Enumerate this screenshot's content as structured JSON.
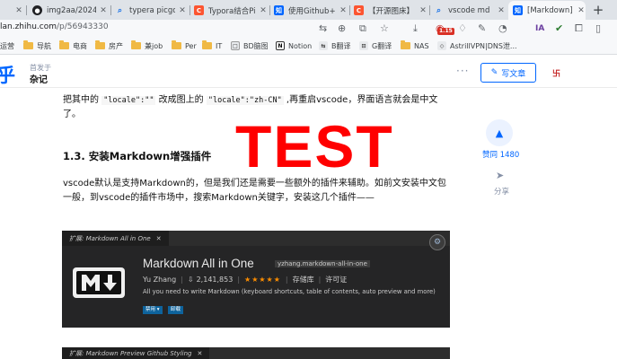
{
  "browser": {
    "tabs": [
      {
        "title": "",
        "icon": "page-icon",
        "color": "#5f6368"
      },
      {
        "title": "img2aa/2024",
        "icon": "github-icon",
        "color": "#202124"
      },
      {
        "title": "typera picgo",
        "icon": "search-icon",
        "color": "#1a73e8"
      },
      {
        "title": "Typora结合Pic",
        "icon": "csdn-icon",
        "color": "#fc5531"
      },
      {
        "title": "使用Github+p",
        "icon": "zhihu-icon",
        "color": "#0066ff"
      },
      {
        "title": "【开源图床】",
        "icon": "csdn-icon",
        "color": "#fc5531"
      },
      {
        "title": "vscode md",
        "icon": "search-icon",
        "color": "#1a73e8"
      },
      {
        "title": "[Markdown]",
        "icon": "zhihu-icon",
        "color": "#0066ff"
      }
    ],
    "url_host": "lan.zhihu.com",
    "url_path": "/p/56943330",
    "badge": "1.15"
  },
  "bookmarks": [
    {
      "label": "运营",
      "type": "folder"
    },
    {
      "label": "导航",
      "type": "folder"
    },
    {
      "label": "电商",
      "type": "folder"
    },
    {
      "label": "房产",
      "type": "folder"
    },
    {
      "label": "兼job",
      "type": "folder"
    },
    {
      "label": "Per",
      "type": "folder"
    },
    {
      "label": "IT",
      "type": "folder"
    },
    {
      "label": "BD脑图",
      "type": "site"
    },
    {
      "label": "Notion",
      "type": "site"
    },
    {
      "label": "B翻译",
      "type": "site"
    },
    {
      "label": "G翻译",
      "type": "site"
    },
    {
      "label": "NAS",
      "type": "folder"
    },
    {
      "label": "AstrillVPN|DNS泄...",
      "type": "site"
    }
  ],
  "zhihu": {
    "logo": "乎",
    "published_in_label": "首发于",
    "column_name": "杂记",
    "more": "···",
    "write_button": "写文章"
  },
  "article": {
    "para1_pre": "把其中的 ",
    "para1_code1": "\"locale\":\"\"",
    "para1_mid": " 改成图上的 ",
    "para1_code2": "\"locale\":\"zh-CN\"",
    "para1_post": " ,再重启vscode，界面语言就会是中文了。",
    "heading": "1.3. 安装Markdown增强插件",
    "para2": "vscode默认是支持Markdown的，但是我们还是需要一些额外的插件来辅助。如前文安装中文包一般，到vscode的插件市场中，搜索Markdown关键字，安装这几个插件——",
    "watermark": "TEST"
  },
  "sidebar": {
    "like_label": "赞同 1480",
    "share_label": "分享"
  },
  "extension_card": {
    "tab_label": "扩展: Markdown All in One",
    "title": "Markdown All in One",
    "id": "yzhang.markdown-all-in-one",
    "author": "Yu Zhang",
    "installs": "2,141,853",
    "stars": "★★★★★",
    "repo": "存储库",
    "license": "许可证",
    "description": "All you need to write Markdown (keyboard shortcuts, table of contents, auto preview and more)",
    "btn_disable": "禁用 ▾",
    "btn_uninstall": "卸载"
  },
  "extension_card2": {
    "tab_label": "扩展: Markdown Preview Github Styling"
  }
}
